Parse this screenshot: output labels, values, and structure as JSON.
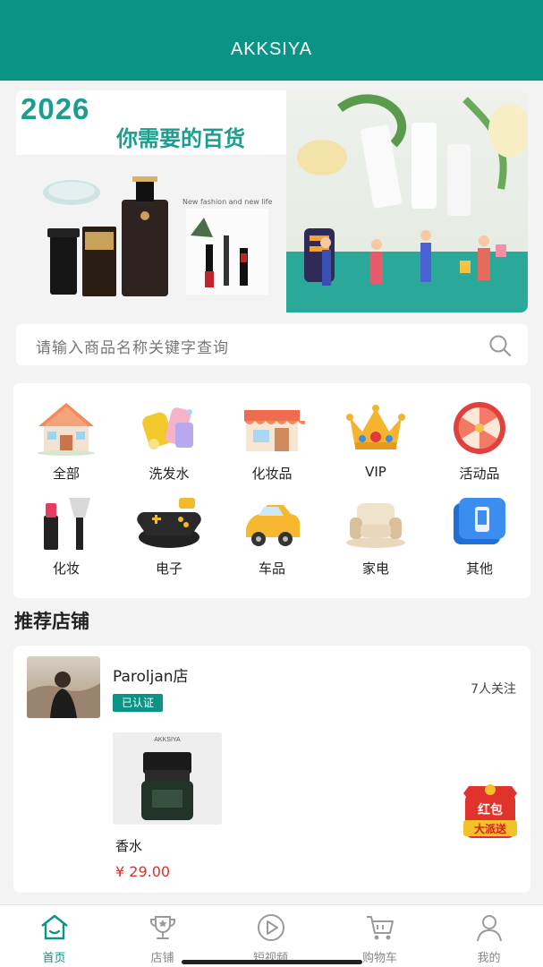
{
  "header": {
    "title": "AKKSIYA"
  },
  "banner": {
    "year": "2026",
    "slogan": "你需要的百货",
    "tagline": "New fashion and new life"
  },
  "search": {
    "placeholder": "请输入商品名称关键字查询",
    "icon": "search-icon"
  },
  "categories": [
    {
      "label": "全部",
      "icon": "house-icon"
    },
    {
      "label": "洗发水",
      "icon": "shampoo-icon"
    },
    {
      "label": "化妆品",
      "icon": "store-icon"
    },
    {
      "label": "VIP",
      "icon": "crown-icon"
    },
    {
      "label": "活动品",
      "icon": "prize-wheel-icon"
    },
    {
      "label": "化妆",
      "icon": "makeup-brush-icon"
    },
    {
      "label": "电子",
      "icon": "gamepad-icon"
    },
    {
      "label": "车品",
      "icon": "car-icon"
    },
    {
      "label": "家电",
      "icon": "sofa-icon"
    },
    {
      "label": "其他",
      "icon": "phone-box-icon"
    }
  ],
  "section": {
    "title": "推荐店铺"
  },
  "shop": {
    "name": "Paroljan店",
    "badge": "已认证",
    "followers": "7人关注",
    "product": {
      "name": "香水",
      "price": "¥ 29.00",
      "brand": "AKKSIYA"
    }
  },
  "redpack": {
    "text1": "红包",
    "text2": "大派送"
  },
  "tabs": [
    {
      "label": "首页",
      "icon": "home-icon",
      "active": true
    },
    {
      "label": "店铺",
      "icon": "trophy-icon",
      "active": false
    },
    {
      "label": "短视频",
      "icon": "play-icon",
      "active": false
    },
    {
      "label": "购物车",
      "icon": "cart-icon",
      "active": false
    },
    {
      "label": "我的",
      "icon": "user-icon",
      "active": false
    }
  ],
  "colors": {
    "brand": "#0a9485",
    "price": "#d6332b"
  }
}
